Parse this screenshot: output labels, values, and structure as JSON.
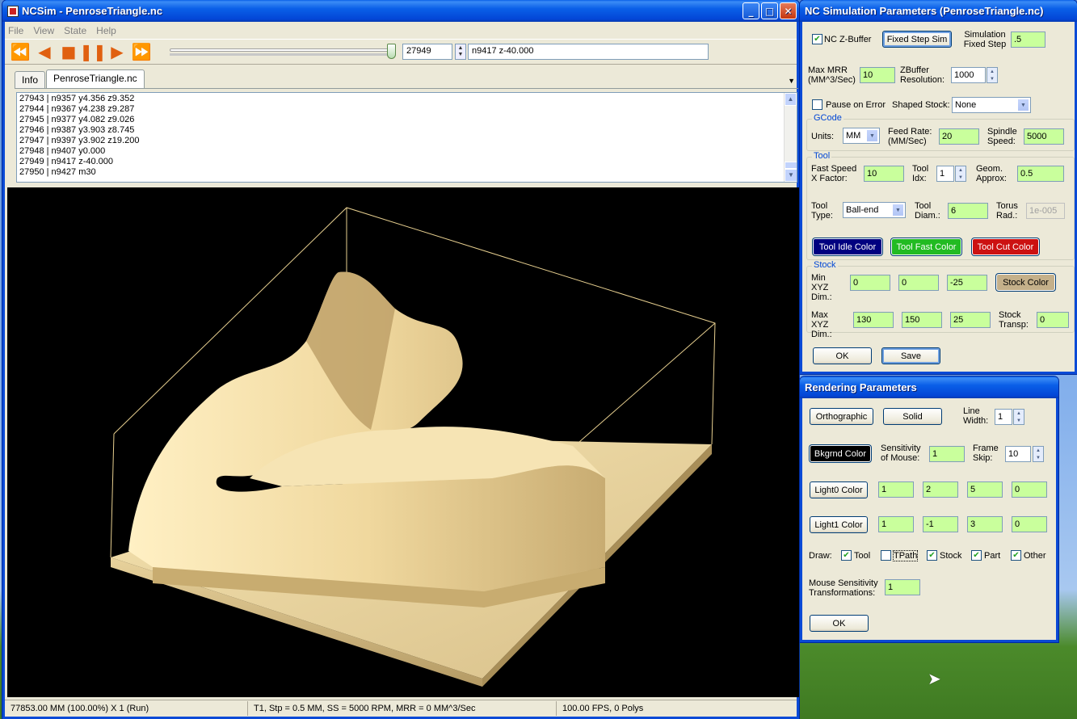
{
  "main_window": {
    "title": "NCSim - PenroseTriangle.nc",
    "menu": [
      "File",
      "View",
      "State",
      "Help"
    ],
    "toolbar": {
      "line_number": "27949",
      "current_command": "n9417 z-40.000",
      "progress": 1.0
    },
    "tabs": [
      "Info",
      "PenroseTriangle.nc"
    ],
    "log_lines": [
      "27943 | n9357 y4.356 z9.352",
      "27944 | n9367 y4.238 z9.287",
      "27945 | n9377 y4.082 z9.026",
      "27946 | n9387 y3.903 z8.745",
      "27947 | n9397 y3.902 z19.200",
      "27948 | n9407 y0.000",
      "27949 | n9417 z-40.000",
      "27950 | n9427 m30"
    ],
    "status": {
      "position": "77853.00 MM (100.00%) X 1 (Run)",
      "tool": "T1, Stp = 0.5 MM, SS = 5000 RPM, MRR = 0 MM^3/Sec",
      "fps": "100.00 FPS, 0 Polys"
    },
    "colors": {
      "viewport_bg": "#000000",
      "stock": "#f2dca4",
      "bbox_line": "#e8d090"
    }
  },
  "nc_window": {
    "title": "NC Simulation Parameters (PenroseTriangle.nc)",
    "nc_zbuffer_label": "NC Z-Buffer",
    "nc_zbuffer_checked": true,
    "fixed_step_button": "Fixed Step Sim",
    "sim_fixed_step_label": "Simulation Fixed Step",
    "sim_fixed_step_value": ".5",
    "max_mrr_label": "Max MRR (MM^3/Sec)",
    "max_mrr_value": "10",
    "zbuffer_res_label": "ZBuffer Resolution:",
    "zbuffer_res_value": "1000",
    "pause_on_error_label": "Pause on Error",
    "pause_on_error_checked": false,
    "shaped_stock_label": "Shaped Stock:",
    "shaped_stock_value": "None",
    "gcode": {
      "group_label": "GCode",
      "units_label": "Units:",
      "units_value": "MM",
      "feed_rate_label": "Feed Rate: (MM/Sec)",
      "feed_rate_value": "20",
      "spindle_label": "Spindle Speed:",
      "spindle_value": "5000"
    },
    "tool": {
      "group_label": "Tool",
      "fast_speed_label": "Fast Speed X Factor:",
      "fast_speed_value": "10",
      "tool_idx_label": "Tool Idx:",
      "tool_idx_value": "1",
      "geom_label": "Geom. Approx:",
      "geom_value": "0.5",
      "tool_type_label": "Tool Type:",
      "tool_type_value": "Ball-end",
      "tool_diam_label": "Tool Diam.:",
      "tool_diam_value": "6",
      "torus_label": "Torus Rad.:",
      "torus_value": "1e-005",
      "idle_color_button": "Tool Idle Color",
      "fast_color_button": "Tool Fast Color",
      "cut_color_button": "Tool Cut Color",
      "idle_color": "#000080",
      "fast_color": "#22bb22",
      "cut_color": "#cc1111"
    },
    "stock": {
      "group_label": "Stock",
      "min_label": "Min XYZ Dim.:",
      "min_values": [
        "0",
        "0",
        "-25"
      ],
      "stock_color_button": "Stock Color",
      "stock_color": "#c4b08a",
      "max_label": "Max XYZ Dim.:",
      "max_values": [
        "130",
        "150",
        "25"
      ],
      "transp_label": "Stock Transp:",
      "transp_value": "0"
    },
    "ok_button": "OK",
    "save_button": "Save"
  },
  "render_window": {
    "title": "Rendering Parameters",
    "ortho_button": "Orthographic",
    "solid_button": "Solid",
    "line_width_label": "Line Width:",
    "line_width_value": "1",
    "bkgrnd_button": "Bkgrnd Color",
    "sensitivity_label": "Sensitivity of Mouse:",
    "sensitivity_value": "1",
    "frame_skip_label": "Frame Skip:",
    "frame_skip_value": "10",
    "light0_button": "Light0 Color",
    "light0_values": [
      "1",
      "2",
      "5",
      "0"
    ],
    "light1_button": "Light1 Color",
    "light1_values": [
      "1",
      "-1",
      "3",
      "0"
    ],
    "draw_label": "Draw:",
    "draw_options": [
      {
        "label": "Tool",
        "checked": true
      },
      {
        "label": "TPath",
        "checked": false
      },
      {
        "label": "Stock",
        "checked": true
      },
      {
        "label": "Part",
        "checked": true
      },
      {
        "label": "Other",
        "checked": true
      }
    ],
    "mouse_transform_label": "Mouse Sensitivity Transformations:",
    "mouse_transform_value": "1",
    "ok_button": "OK"
  }
}
